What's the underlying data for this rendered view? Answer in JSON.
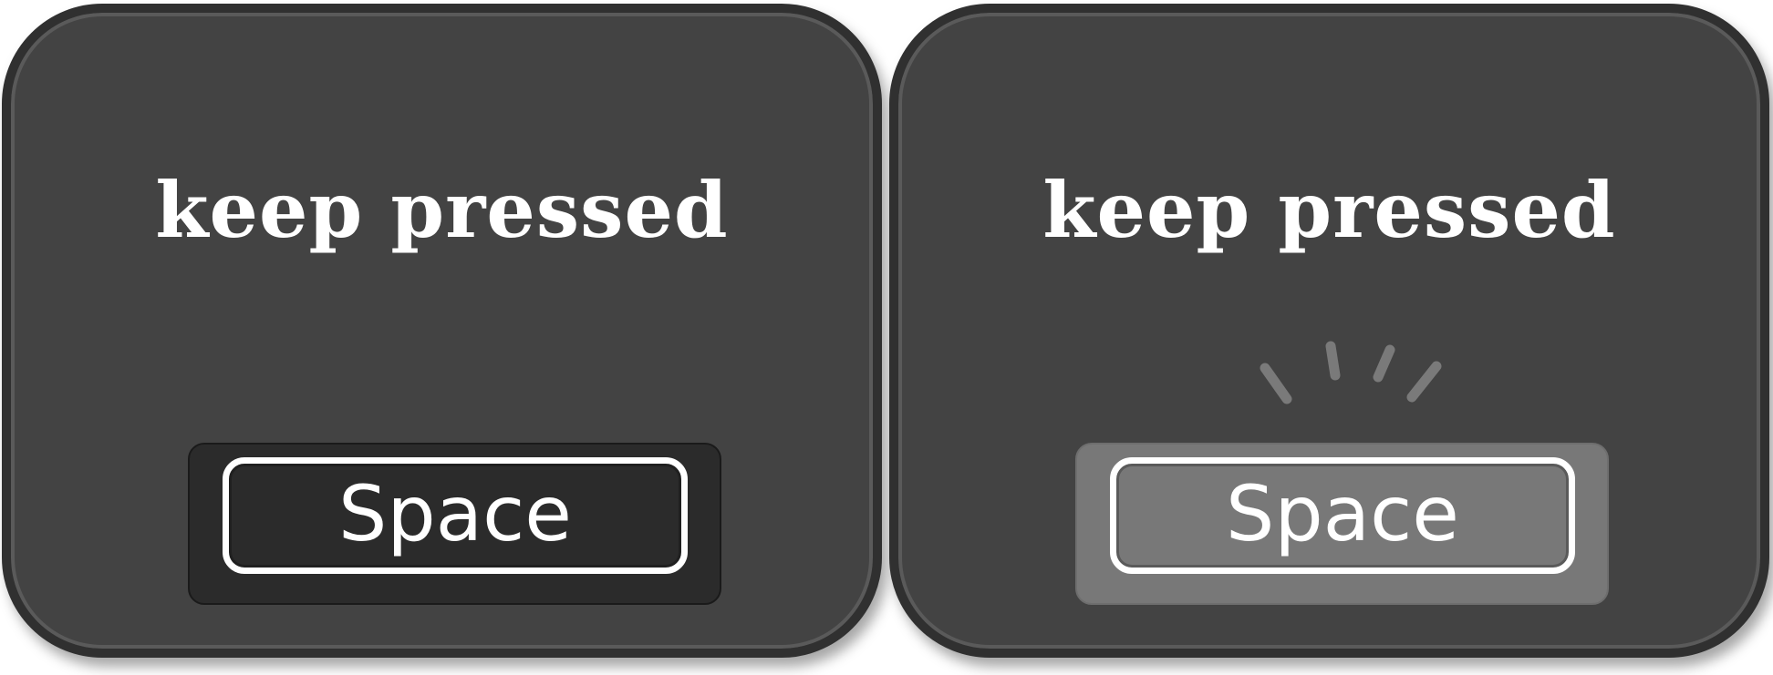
{
  "panels": [
    {
      "state": "idle",
      "title": "keep pressed",
      "key_label": "Space"
    },
    {
      "state": "pressed",
      "title": "keep pressed",
      "key_label": "Space"
    }
  ],
  "colors": {
    "panel_bg": "#434343",
    "panel_border": "#303030",
    "key_idle_bg": "#2b2b2b",
    "key_pressed_bg": "#787878",
    "press_lines": "#7a7a7a",
    "text": "#ffffff"
  },
  "icons": {
    "press_indicator": "press-lines-icon"
  }
}
